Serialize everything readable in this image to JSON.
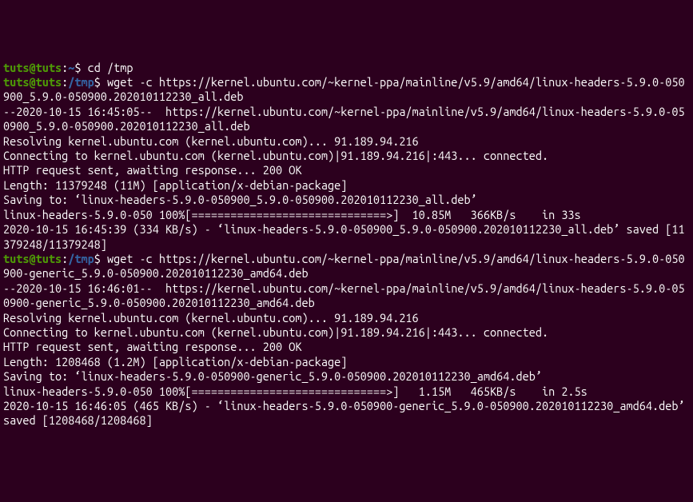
{
  "prompt": {
    "user": "tuts",
    "host": "tuts",
    "home_path": "~",
    "tmp_path": "/tmp",
    "dollar": "$"
  },
  "cmd1": "cd /tmp",
  "cmd2": "wget -c https://kernel.ubuntu.com/~kernel-ppa/mainline/v5.9/amd64/linux-headers-5.9.0-050900_5.9.0-050900.202010112230_all.deb",
  "block1": {
    "l1": "--2020-10-15 16:45:05--  https://kernel.ubuntu.com/~kernel-ppa/mainline/v5.9/amd64/linux-headers-5.9.0-050900_5.9.0-050900.202010112230_all.deb",
    "l2": "Resolving kernel.ubuntu.com (kernel.ubuntu.com)... 91.189.94.216",
    "l3": "Connecting to kernel.ubuntu.com (kernel.ubuntu.com)|91.189.94.216|:443... connected.",
    "l4": "HTTP request sent, awaiting response... 200 OK",
    "l5": "Length: 11379248 (11M) [application/x-debian-package]",
    "l6": "Saving to: ‘linux-headers-5.9.0-050900_5.9.0-050900.202010112230_all.deb’",
    "l7": "",
    "l8": "linux-headers-5.9.0-050 100%[==============================>]  10.85M   366KB/s    in 33s",
    "l9": "",
    "l10": "2020-10-15 16:45:39 (334 KB/s) - ‘linux-headers-5.9.0-050900_5.9.0-050900.202010112230_all.deb’ saved [11379248/11379248]",
    "l11": ""
  },
  "cmd3": "wget -c https://kernel.ubuntu.com/~kernel-ppa/mainline/v5.9/amd64/linux-headers-5.9.0-050900-generic_5.9.0-050900.202010112230_amd64.deb",
  "block2": {
    "l1": "--2020-10-15 16:46:01--  https://kernel.ubuntu.com/~kernel-ppa/mainline/v5.9/amd64/linux-headers-5.9.0-050900-generic_5.9.0-050900.202010112230_amd64.deb",
    "l2": "Resolving kernel.ubuntu.com (kernel.ubuntu.com)... 91.189.94.216",
    "l3": "Connecting to kernel.ubuntu.com (kernel.ubuntu.com)|91.189.94.216|:443... connected.",
    "l4": "HTTP request sent, awaiting response... 200 OK",
    "l5": "Length: 1208468 (1.2M) [application/x-debian-package]",
    "l6": "Saving to: ‘linux-headers-5.9.0-050900-generic_5.9.0-050900.202010112230_amd64.deb’",
    "l7": "",
    "l8": "linux-headers-5.9.0-050 100%[==============================>]   1.15M   465KB/s    in 2.5s",
    "l9": "",
    "l10": "2020-10-15 16:46:05 (465 KB/s) - ‘linux-headers-5.9.0-050900-generic_5.9.0-050900.202010112230_amd64.deb’ saved [1208468/1208468]"
  }
}
